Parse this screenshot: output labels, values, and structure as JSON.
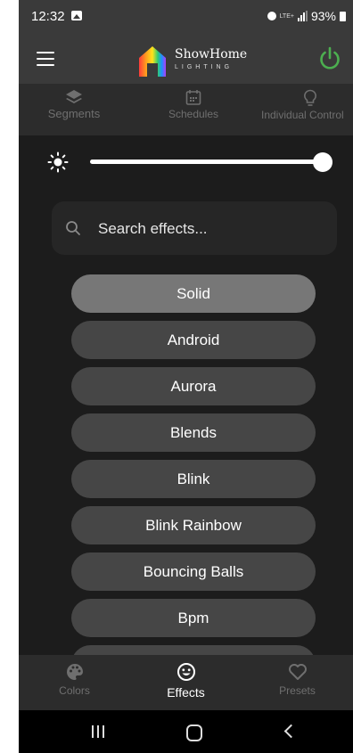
{
  "status_bar": {
    "time": "12:32",
    "network": "LTE+",
    "battery": "93%"
  },
  "header": {
    "brand_name": "ShowHome",
    "brand_sub": "LIGHTING"
  },
  "top_tabs": [
    {
      "label": "Segments",
      "icon": "layers-icon"
    },
    {
      "label": "Schedules",
      "icon": "calendar-icon"
    },
    {
      "label": "Individual Control",
      "icon": "bulb-icon"
    }
  ],
  "brightness": {
    "level": 1.0
  },
  "search": {
    "placeholder": "Search effects..."
  },
  "effects": {
    "selected": "Solid",
    "items": [
      "Solid",
      "Android",
      "Aurora",
      "Blends",
      "Blink",
      "Blink Rainbow",
      "Bouncing Balls",
      "Bpm"
    ]
  },
  "bottom_nav": [
    {
      "label": "Colors",
      "icon": "palette-icon",
      "active": false
    },
    {
      "label": "Effects",
      "icon": "smiley-icon",
      "active": true
    },
    {
      "label": "Presets",
      "icon": "heart-icon",
      "active": false
    }
  ],
  "colors": {
    "background": "#1c1c1c",
    "header": "#3a3a3a",
    "pill": "#464646",
    "pill_selected": "#777777",
    "power": "#4caf50"
  }
}
